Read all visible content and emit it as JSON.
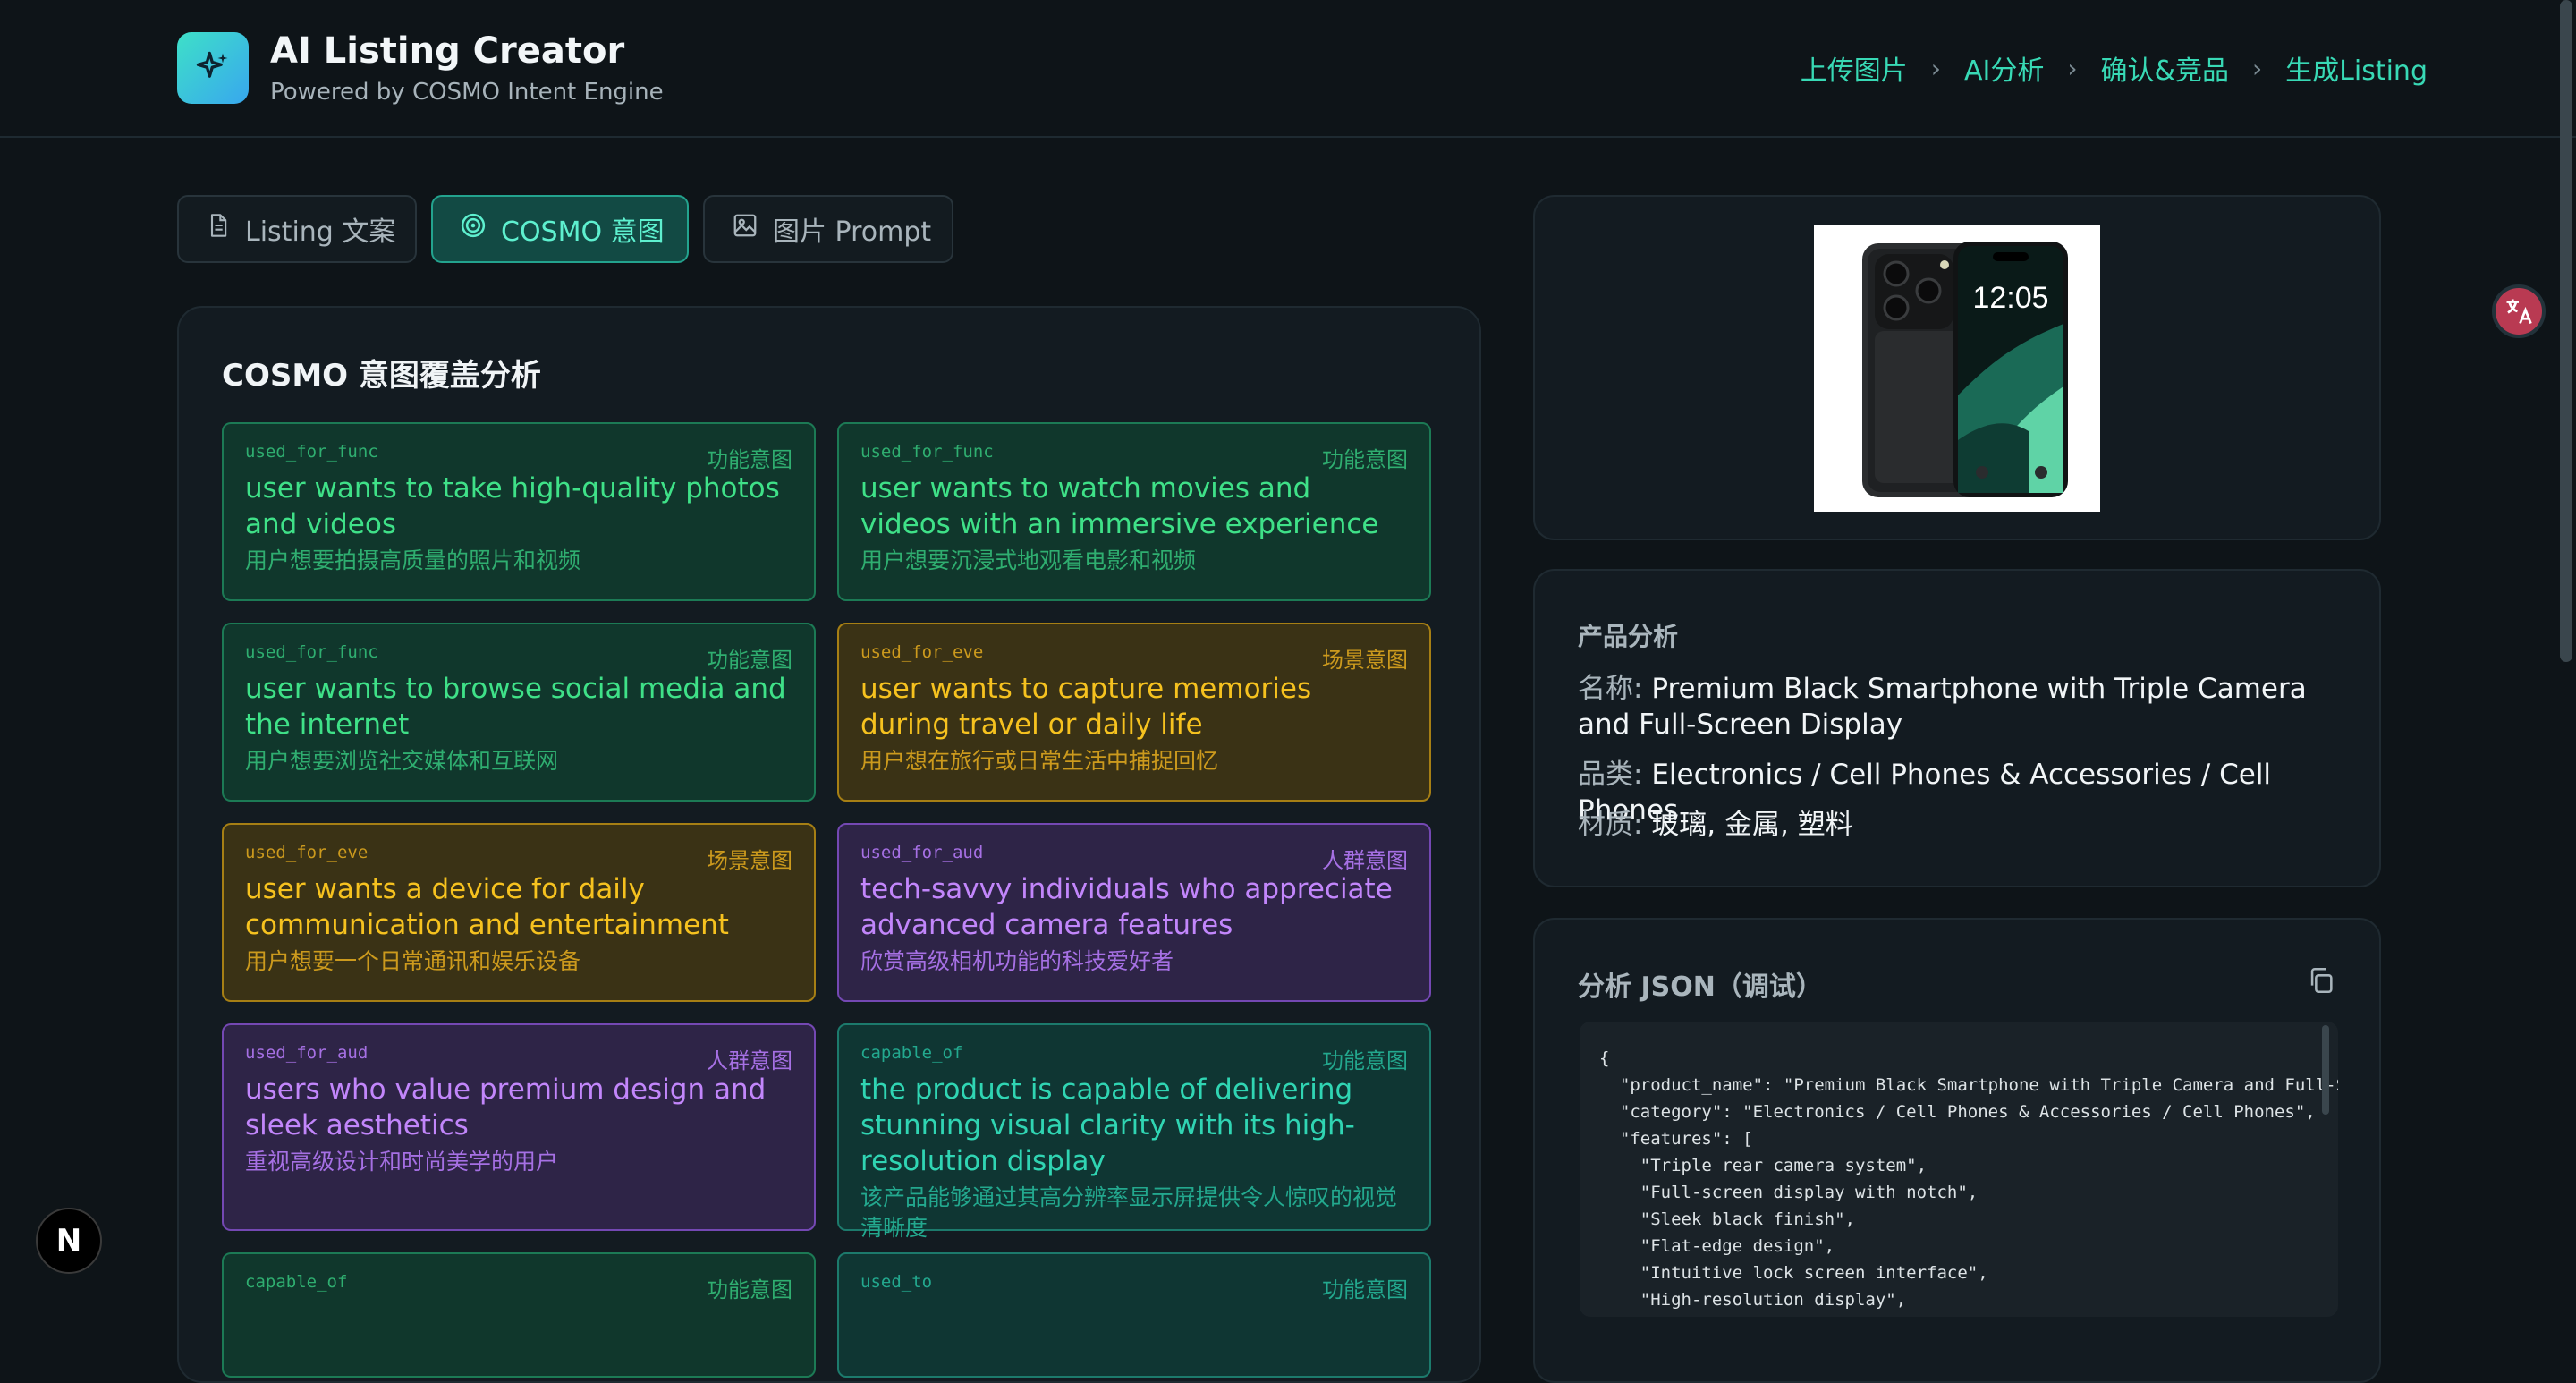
{
  "app": {
    "title": "AI Listing Creator",
    "subtitle": "Powered by COSMO Intent Engine",
    "logo_icon": "sparkle-icon"
  },
  "steps": [
    "上传图片",
    "AI分析",
    "确认&竞品",
    "生成Listing"
  ],
  "tabs": [
    {
      "label": "Listing 文案",
      "icon": "document-icon",
      "active": false
    },
    {
      "label": "COSMO 意图",
      "icon": "target-icon",
      "active": true
    },
    {
      "label": "图片 Prompt",
      "icon": "image-icon",
      "active": false
    }
  ],
  "cosmo": {
    "section_title": "COSMO 意图覆盖分析",
    "intents": [
      {
        "key": "used_for_func",
        "type": "功能意图",
        "en": "user wants to take high-quality photos and videos",
        "zh": "用户想要拍摄高质量的照片和视频"
      },
      {
        "key": "used_for_func",
        "type": "功能意图",
        "en": "user wants to watch movies and videos with an immersive experience",
        "zh": "用户想要沉浸式地观看电影和视频"
      },
      {
        "key": "used_for_func",
        "type": "功能意图",
        "en": "user wants to browse social media and the internet",
        "zh": "用户想要浏览社交媒体和互联网"
      },
      {
        "key": "used_for_eve",
        "type": "场景意图",
        "en": "user wants to capture memories during travel or daily life",
        "zh": "用户想在旅行或日常生活中捕捉回忆"
      },
      {
        "key": "used_for_eve",
        "type": "场景意图",
        "en": "user wants a device for daily communication and entertainment",
        "zh": "用户想要一个日常通讯和娱乐设备"
      },
      {
        "key": "used_for_aud",
        "type": "人群意图",
        "en": "tech-savvy individuals who appreciate advanced camera features",
        "zh": "欣赏高级相机功能的科技爱好者"
      },
      {
        "key": "used_for_aud",
        "type": "人群意图",
        "en": "users who value premium design and sleek aesthetics",
        "zh": "重视高级设计和时尚美学的用户"
      },
      {
        "key": "capable_of",
        "type": "功能意图",
        "en": "the product is capable of delivering stunning visual clarity with its high-resolution display",
        "zh": "该产品能够通过其高分辨率显示屏提供令人惊叹的视觉清晰度"
      },
      {
        "key": "capable_of",
        "type": "功能意图"
      },
      {
        "key": "used_to",
        "type": "功能意图"
      }
    ]
  },
  "product": {
    "image_alt": "Black smartphone with triple camera",
    "screen_time": "12:05"
  },
  "analysis": {
    "title": "产品分析",
    "name_label": "名称:",
    "name_value": "Premium Black Smartphone with Triple Camera and Full-Screen Display",
    "category_label": "品类:",
    "category_value": "Electronics / Cell Phones & Accessories / Cell Phones",
    "material_label": "材质:",
    "material_value": "玻璃, 金属, 塑料"
  },
  "json_debug": {
    "title": "分析 JSON（调试）",
    "code": "{\n  \"product_name\": \"Premium Black Smartphone with Triple Camera and Full-S\n  \"category\": \"Electronics / Cell Phones & Accessories / Cell Phones\",\n  \"features\": [\n    \"Triple rear camera system\",\n    \"Full-screen display with notch\",\n    \"Sleek black finish\",\n    \"Flat-edge design\",\n    \"Intuitive lock screen interface\",\n    \"High-resolution display\","
  },
  "misc": {
    "translate_icon": "translate-icon",
    "next_badge": "N"
  }
}
